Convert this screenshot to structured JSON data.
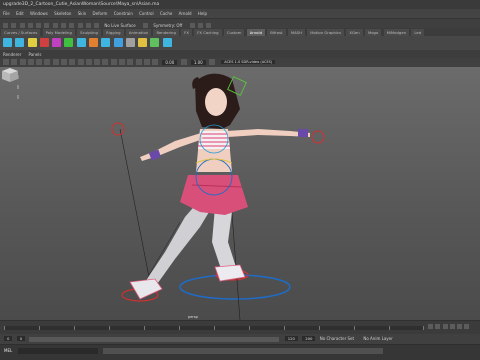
{
  "window": {
    "title": "upgrade3D_2_Cartoon_Cutie_AsianWoman\\Source\\Maya_sn\\Asian.ma"
  },
  "menus": [
    "File",
    "Edit",
    "Windows",
    "Skeleton",
    "Skin",
    "Deform",
    "Constrain",
    "Control",
    "Cache",
    "Arnold",
    "Help"
  ],
  "status_line": {
    "no_live_surface": "No Live Surface",
    "symmetry": "Symmetry: Off"
  },
  "shelf_tabs": [
    "Curves / Surfaces",
    "Poly Modeling",
    "Sculpting",
    "Rigging",
    "Animation",
    "Rendering",
    "FX",
    "FX Caching",
    "Custom",
    "Arnold",
    "Bifrost",
    "MASH",
    "Motion Graphics",
    "XGen",
    "Mogo",
    "MiModgen",
    "Led"
  ],
  "active_shelf_tab": "Arnold",
  "shelf_icon_colors": [
    "#3fb6e0",
    "#3fb6e0",
    "#e0d040",
    "#d04040",
    "#c040c0",
    "#40c040",
    "#3fb6e0",
    "#e08030",
    "#3fb6e0",
    "#40a0e0",
    "#a0a0a0",
    "#e0c040",
    "#60c060",
    "#3fb6e0"
  ],
  "panel_menu": [
    "Renderer",
    "Panels"
  ],
  "panel_toolbar": {
    "value_a": "0.00",
    "value_b": "1.00",
    "color_management": "ACES 1.0 SDR-video (ACES)"
  },
  "viewport": {
    "camera": "persp"
  },
  "range": {
    "start_frame": "0",
    "range_start": "0",
    "range_end": "120",
    "end_frame": "200",
    "character_set": "No Character Set",
    "anim_layer": "No Anim Layer"
  },
  "command_line": {
    "language": "MEL"
  },
  "colors": {
    "accent": "#5d5d5d",
    "viewport_top": "#6b6b6b",
    "rig_ring": "#1e6cc8"
  }
}
